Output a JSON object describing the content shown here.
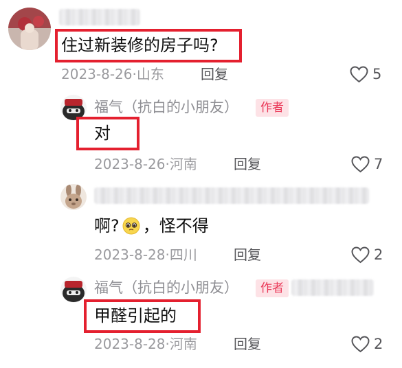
{
  "comments": [
    {
      "username": "",
      "content": "住过新装修的房子吗?",
      "date": "2023-8-26",
      "location": "山东",
      "reply_label": "回复",
      "likes": "5"
    },
    {
      "username": "福气（抗白的小朋友）",
      "author_badge": "作者",
      "content": "对",
      "date": "2023-8-26",
      "location": "河南",
      "reply_label": "回复",
      "likes": "7"
    },
    {
      "username": "",
      "content_before": "啊?",
      "content_after": "，怪不得",
      "emoji": "pleading-face-emoji",
      "date": "2023-8-28",
      "location": "四川",
      "reply_label": "回复",
      "likes": "2"
    },
    {
      "username": "福气（抗白的小朋友）",
      "author_badge": "作者",
      "content": "甲醛引起的",
      "date": "2023-8-28",
      "location": "河南",
      "reply_label": "回复",
      "likes": "2"
    }
  ],
  "colors": {
    "highlight_box": "#e4202f",
    "author_badge_bg": "#fde2e6",
    "author_badge_text": "#ea3a59",
    "meta_text": "#9a9a9e"
  }
}
